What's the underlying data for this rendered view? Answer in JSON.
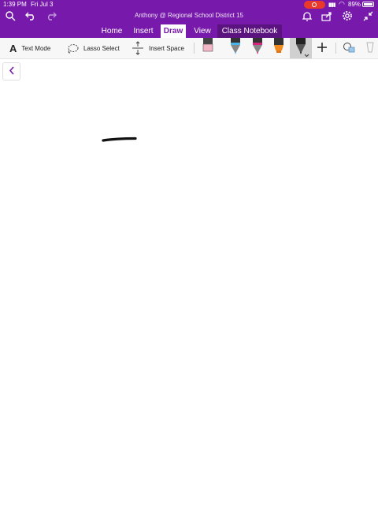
{
  "status_bar": {
    "time": "1:39 PM",
    "date": "Fri Jul 3",
    "battery": "89%"
  },
  "header": {
    "title": "Anthony @ Regional School District 15",
    "icons": [
      "search-icon",
      "undo-icon",
      "redo-icon",
      "bell-icon",
      "share-icon",
      "settings-icon",
      "collapse-icon"
    ],
    "background": "#7719aa"
  },
  "tabs": [
    {
      "label": "Home"
    },
    {
      "label": "Insert"
    },
    {
      "label": "Draw",
      "active": true
    },
    {
      "label": "View"
    },
    {
      "label": "Class Notebook"
    }
  ],
  "toolbar": {
    "text_mode": "Text Mode",
    "lasso_select": "Lasso Select",
    "insert_space": "Insert Space",
    "pens": [
      {
        "name": "eraser",
        "color": "#f2b6c6"
      },
      {
        "name": "blue-pen",
        "color": "#48b5e8"
      },
      {
        "name": "pink-pen",
        "color": "#d6237e"
      },
      {
        "name": "orange-highlighter",
        "color": "#f28a1e"
      },
      {
        "name": "black-pen",
        "color": "#222222",
        "selected": true
      }
    ]
  },
  "canvas": {
    "ink_color": "#111111"
  }
}
